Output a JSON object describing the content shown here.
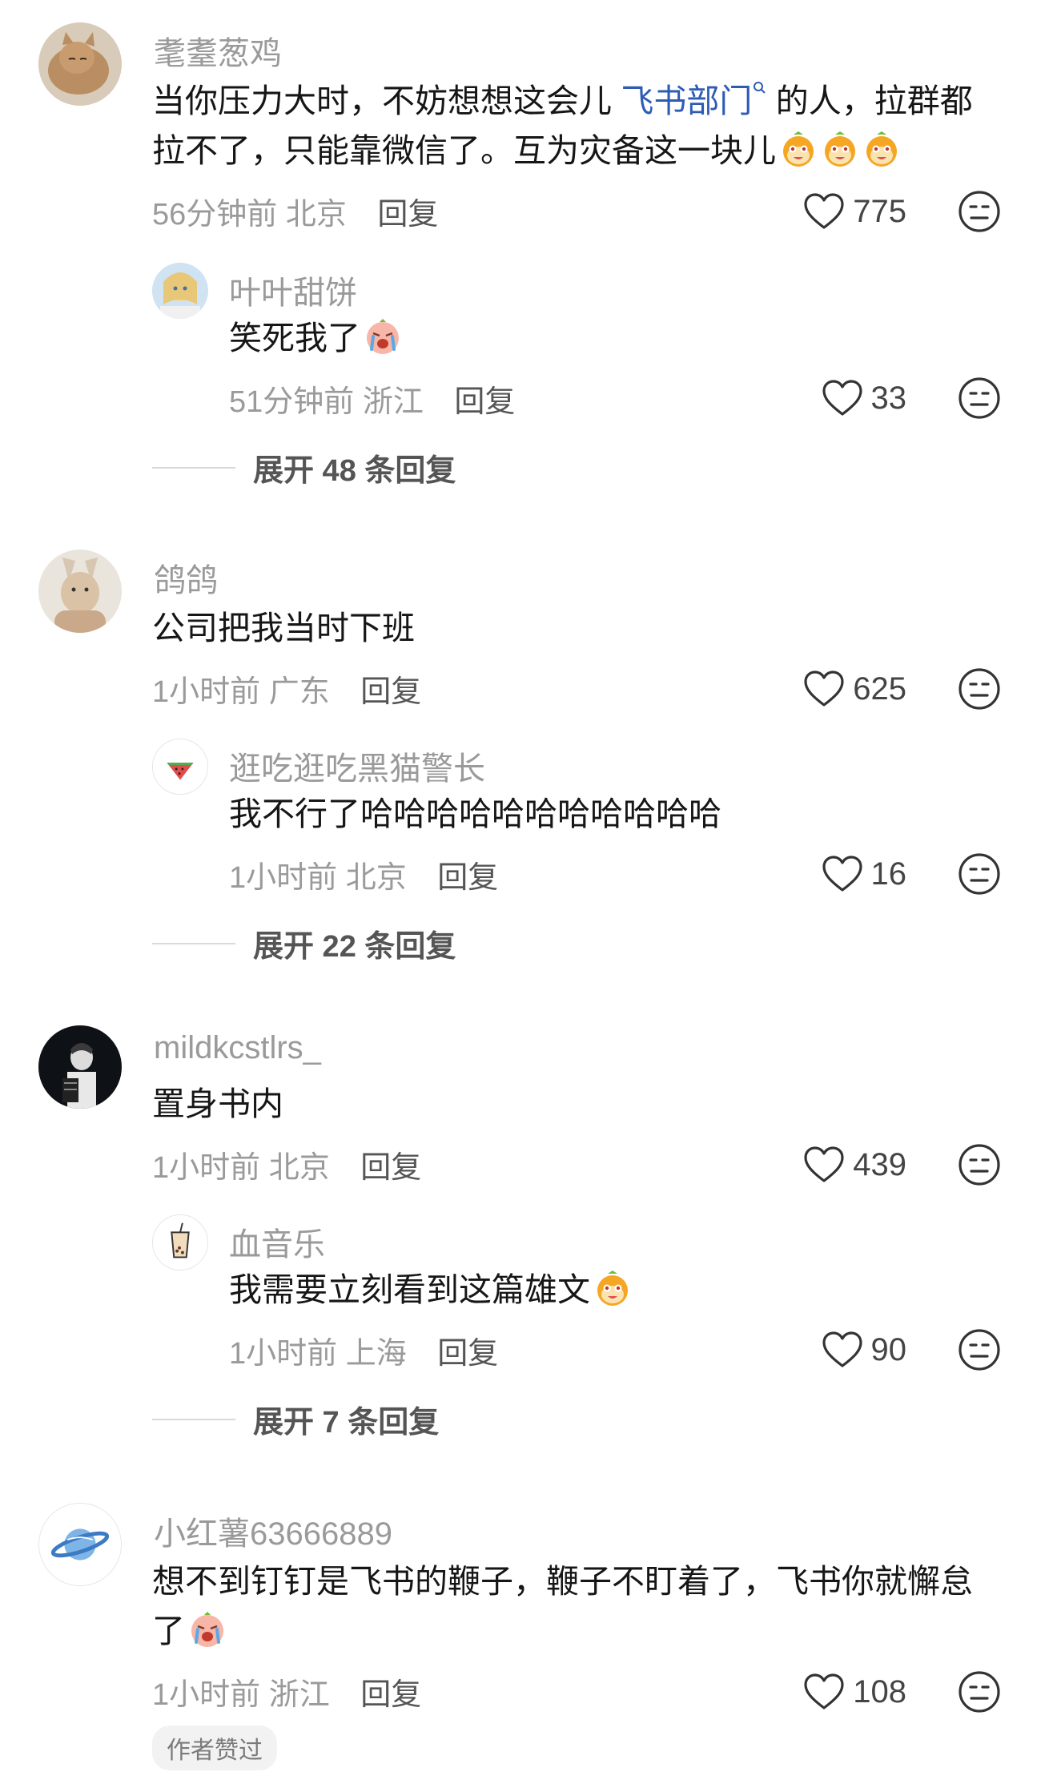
{
  "comments": [
    {
      "user": "耄耋葱鸡",
      "text_line1_before": "当你压力大时，不妨想想这会儿 ",
      "text_link": "飞书部门",
      "text_line1_after": " 的人，拉群都",
      "text_line2": "拉不了，只能靠微信了。互为灾备这一块儿",
      "time": "56分钟前",
      "location": "北京",
      "reply_label": "回复",
      "likes": "775",
      "reply": {
        "user": "叶叶甜饼",
        "text": "笑死我了",
        "time": "51分钟前",
        "location": "浙江",
        "reply_label": "回复",
        "likes": "33"
      },
      "expand_label": "展开 48 条回复"
    },
    {
      "user": "鸽鸽",
      "text": "公司把我当时下班",
      "time": "1小时前",
      "location": "广东",
      "reply_label": "回复",
      "likes": "625",
      "reply": {
        "user": "逛吃逛吃黑猫警长",
        "text": "我不行了哈哈哈哈哈哈哈哈哈哈哈",
        "time": "1小时前",
        "location": "北京",
        "reply_label": "回复",
        "likes": "16"
      },
      "expand_label": "展开 22 条回复"
    },
    {
      "user": "mildkcstlrs_",
      "text": "置身书内",
      "time": "1小时前",
      "location": "北京",
      "reply_label": "回复",
      "likes": "439",
      "reply": {
        "user": "血音乐",
        "text": "我需要立刻看到这篇雄文",
        "time": "1小时前",
        "location": "上海",
        "reply_label": "回复",
        "likes": "90"
      },
      "expand_label": "展开 7 条回复"
    },
    {
      "user": "小红薯63666889",
      "text_line1": "想不到钉钉是飞书的鞭子，鞭子不盯着了，飞书你就懈怠",
      "text_line2": "了",
      "time": "1小时前",
      "location": "浙江",
      "reply_label": "回复",
      "likes": "108",
      "author_badge": "作者赞过"
    }
  ],
  "colors": {
    "link": "#2d5cb5",
    "meta_text": "#9a9a9a",
    "emoji_orange": "#f5a623"
  },
  "icons": [
    "heart-icon",
    "dislike-face-icon",
    "search-icon",
    "emoji"
  ]
}
